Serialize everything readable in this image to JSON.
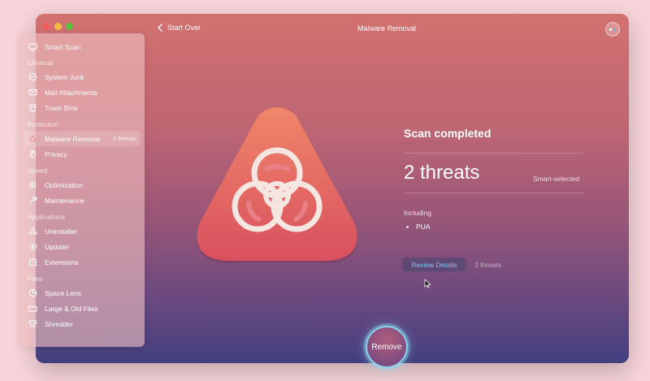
{
  "window": {
    "title": "Malware Removal"
  },
  "toolbar": {
    "back_label": "Start Over"
  },
  "sidebar": {
    "top_item": {
      "label": "Smart Scan",
      "icon": "smart-scan-icon"
    },
    "sections": [
      {
        "label": "Cleanup",
        "items": [
          {
            "label": "System Junk",
            "icon": "system-junk-icon"
          },
          {
            "label": "Mail Attachments",
            "icon": "mail-icon"
          },
          {
            "label": "Trash Bins",
            "icon": "trash-icon"
          }
        ]
      },
      {
        "label": "Protection",
        "items": [
          {
            "label": "Malware Removal",
            "icon": "biohazard-icon",
            "badge": "2 threats",
            "active": true
          },
          {
            "label": "Privacy",
            "icon": "privacy-icon"
          }
        ]
      },
      {
        "label": "Speed",
        "items": [
          {
            "label": "Optimization",
            "icon": "optimization-icon"
          },
          {
            "label": "Maintenance",
            "icon": "wrench-icon"
          }
        ]
      },
      {
        "label": "Applications",
        "items": [
          {
            "label": "Uninstaller",
            "icon": "uninstaller-icon"
          },
          {
            "label": "Updater",
            "icon": "updater-icon"
          },
          {
            "label": "Extensions",
            "icon": "extensions-icon"
          }
        ]
      },
      {
        "label": "Files",
        "items": [
          {
            "label": "Space Lens",
            "icon": "space-lens-icon"
          },
          {
            "label": "Large & Old Files",
            "icon": "folder-icon"
          },
          {
            "label": "Shredder",
            "icon": "shredder-icon"
          }
        ]
      }
    ]
  },
  "result": {
    "title": "Scan completed",
    "threats": "2 threats",
    "selection_note": "Smart-selected",
    "including_label": "Including",
    "items": [
      "PUA"
    ],
    "review_label": "Review Details",
    "review_count": "2 threats"
  },
  "actions": {
    "remove_label": "Remove"
  },
  "colors": {
    "accent": "#89d7ee",
    "link": "#7fc3f2",
    "background": "#f6d4d9",
    "badge_gradient_top": "#f0866a",
    "badge_gradient_bottom": "#d9505e"
  }
}
